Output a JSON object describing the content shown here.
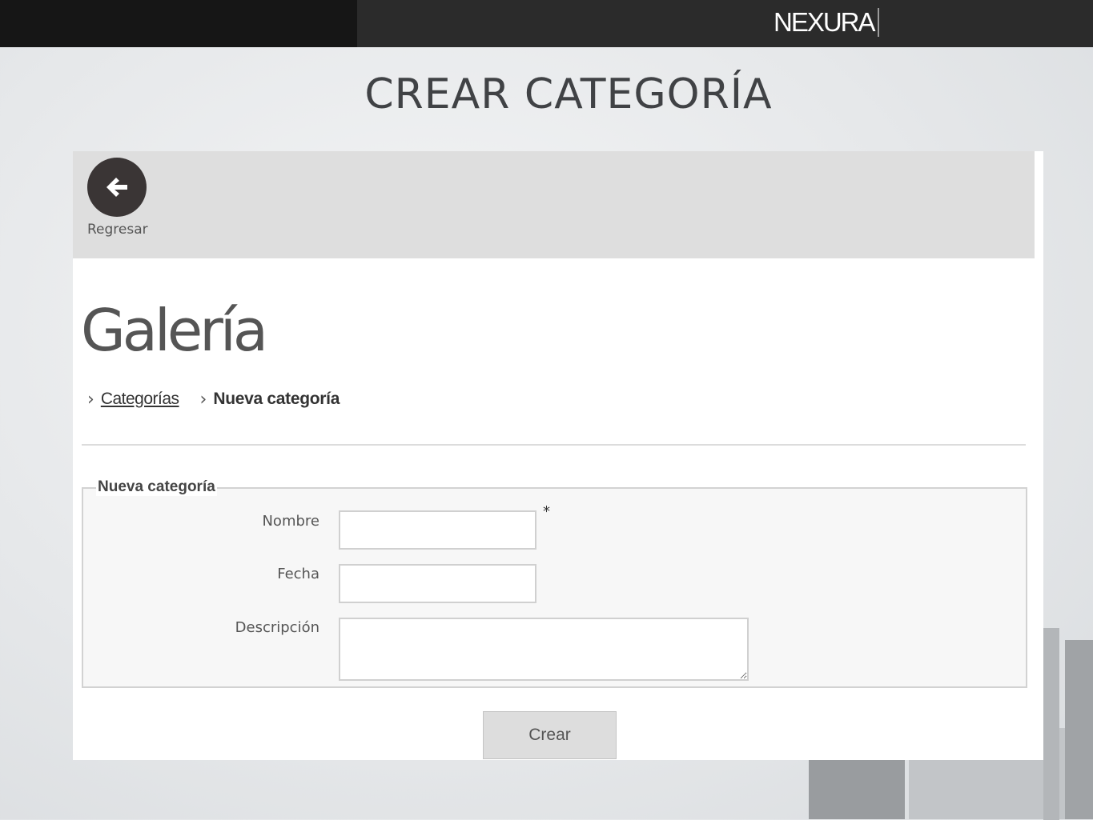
{
  "header": {
    "logo_text": "NEXURA"
  },
  "slide": {
    "title": "CREAR CATEGORÍA"
  },
  "toolbar": {
    "back_label": "Regresar",
    "back_icon": "arrow-left-icon"
  },
  "page": {
    "heading": "Galería"
  },
  "breadcrumb": [
    {
      "label": "Categorías",
      "link": true
    },
    {
      "label": "Nueva categoría",
      "link": false
    }
  ],
  "form": {
    "legend": "Nueva categoría",
    "fields": {
      "nombre": {
        "label": "Nombre",
        "value": "",
        "required_mark": "*"
      },
      "fecha": {
        "label": "Fecha",
        "value": ""
      },
      "descripcion": {
        "label": "Descripción",
        "value": ""
      }
    },
    "submit_label": "Crear"
  },
  "colors": {
    "topbar": "#2b2b2b",
    "toolbar": "#dedede",
    "back_button": "#3a3535",
    "button": "#dddddd"
  }
}
